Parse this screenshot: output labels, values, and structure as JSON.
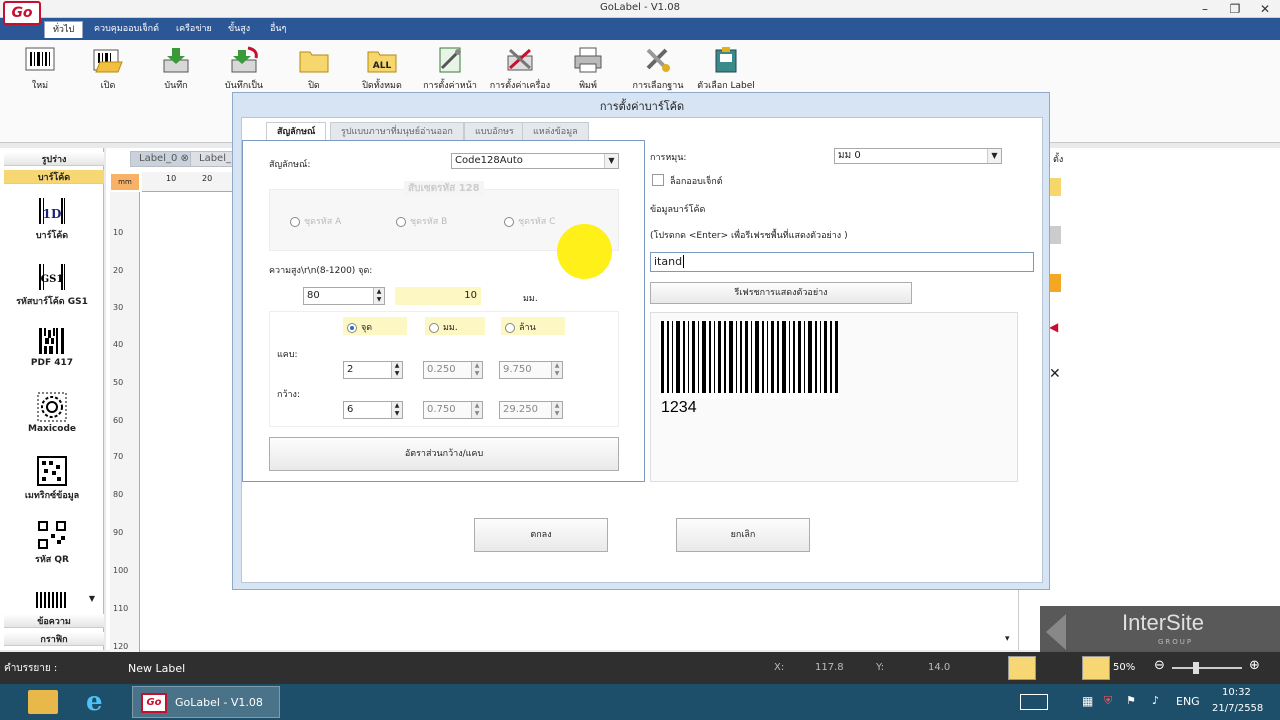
{
  "window": {
    "title": "GoLabel - V1.08",
    "logo_text": "Go"
  },
  "ribbon_tabs": [
    "ทั่วไป",
    "ควบคุมออบเจ็กต์",
    "เครือข่าย",
    "ขั้นสูง",
    "อื่นๆ"
  ],
  "ribbon_buttons": [
    {
      "label": "ใหม่",
      "icon": "new-barcode-icon"
    },
    {
      "label": "เปิด",
      "icon": "open-folder-icon"
    },
    {
      "label": "บันทึก",
      "icon": "save-icon"
    },
    {
      "label": "บันทึกเป็น",
      "icon": "save-as-icon"
    },
    {
      "label": "ปิด",
      "icon": "folder-icon"
    },
    {
      "label": "ปิดทั้งหมด",
      "icon": "close-all-icon"
    },
    {
      "label": "การตั้งค่าหน้า",
      "icon": "page-setup-icon"
    },
    {
      "label": "การตั้งค่าเครื่อง",
      "icon": "printer-setup-icon"
    },
    {
      "label": "พิมพ์",
      "icon": "print-icon"
    },
    {
      "label": "การเลือกฐาน",
      "icon": "database-icon"
    },
    {
      "label": "ตัวเลือก Label",
      "icon": "label-options-icon"
    }
  ],
  "toolbox": {
    "headers": [
      "รูปร่าง",
      "บาร์โค้ด",
      "ข้อความ",
      "กราฟิก"
    ],
    "items": [
      "บาร์โค้ด",
      "รหัสบาร์โค้ด GS1",
      "PDF 417",
      "Maxicode",
      "เมทริกซ์ข้อมูล",
      "รหัส QR"
    ],
    "icon_texts": [
      "1D",
      "GS1"
    ]
  },
  "doc_tabs": [
    "Label_0",
    "Label_"
  ],
  "ruler": {
    "unit": "mm",
    "top_marks": [
      "10",
      "20"
    ],
    "left_marks": [
      "10",
      "20",
      "30",
      "40",
      "50",
      "60",
      "70",
      "80",
      "90",
      "100",
      "110",
      "120"
    ]
  },
  "right_stub_label": "ตั้ง",
  "dialog": {
    "title": "การตั้งค่าบาร์โค้ด",
    "tabs": [
      "สัญลักษณ์",
      "รูปแบบภาษาที่มนุษย์อ่านออก",
      "แบบอักษร",
      "แหล่งข้อมูล"
    ],
    "symbol_label": "สัญลักษณ์:",
    "symbol_value": "Code128Auto",
    "subset_group_title": "สับเซตรหัส 128",
    "subset_options": [
      "ชุดรหัส A",
      "ชุดรหัส B",
      "ชุดรหัส C"
    ],
    "height_label": "ความสูง\\r\\n(8-1200) จุด:",
    "height_value": "80",
    "height_mm": "10",
    "height_unit": "มม.",
    "unit_options": [
      "จุด",
      "มม.",
      "ล้าน"
    ],
    "narrow_label": "แคบ:",
    "wide_label": "กว้าง:",
    "narrow_values": [
      "2",
      "0.250",
      "9.750"
    ],
    "wide_values": [
      "6",
      "0.750",
      "29.250"
    ],
    "ratio_button": "อัตราส่วนกว้าง/แคบ",
    "rotation_label": "การหมุน:",
    "rotation_value": "มม 0",
    "lock_label": "ล็อกออบเจ็กต์",
    "data_label": "ข้อมูลบาร์โค้ด",
    "data_hint": "(โปรดกด <Enter> เพื่อรีเฟรชพื้นที่แสดงตัวอย่าง )",
    "data_value": "itand",
    "refresh_button": "รีเฟรชการแสดงตัวอย่าง",
    "preview_text": "1234",
    "ok_button": "ตกลง",
    "cancel_button": "ยกเลิก"
  },
  "status": {
    "desc_label": "คำบรรยาย :",
    "label_name": "New Label",
    "x_label": "X:",
    "x_value": "117.8",
    "y_label": "Y:",
    "y_value": "14.0",
    "zoom": "50%"
  },
  "watermark": {
    "brand": "InterSite",
    "sub": "GROUP"
  },
  "taskbar": {
    "app_label": "GoLabel - V1.08",
    "lang": "ENG",
    "time": "10:32",
    "date": "21/7/2558"
  },
  "colors": {
    "accent": "#2b5797",
    "brand_red": "#c8102e",
    "highlight": "#ffee00"
  }
}
